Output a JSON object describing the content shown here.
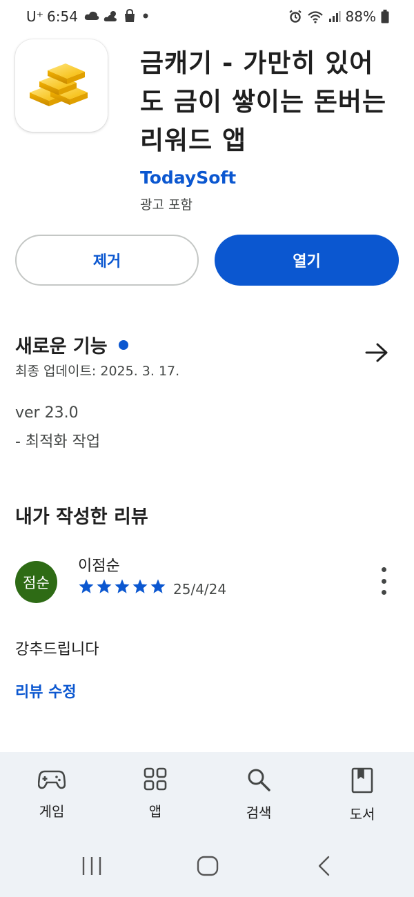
{
  "status_bar": {
    "carrier": "U⁺",
    "time": "6:54",
    "battery": "88%"
  },
  "app": {
    "title": "금캐기 - 가만히 있어도 금이 쌓이는 돈버는 리워드 앱",
    "developer": "TodaySoft",
    "ads_label": "광고 포함",
    "icon": "gold-bars-icon"
  },
  "actions": {
    "remove_label": "제거",
    "open_label": "열기"
  },
  "whats_new": {
    "title": "새로운 기능",
    "updated": "최종 업데이트: 2025. 3. 17.",
    "version": "ver 23.0",
    "note": "- 최적화 작업"
  },
  "my_review": {
    "title": "내가 작성한 리뷰",
    "avatar_text": "점순",
    "reviewer_name": "이점순",
    "rating": 5,
    "max_rating": 5,
    "date": "25/4/24",
    "body": "강추드립니다",
    "edit_label": "리뷰 수정"
  },
  "bottom_nav": {
    "items": [
      {
        "label": "게임",
        "icon": "gamepad-icon"
      },
      {
        "label": "앱",
        "icon": "apps-grid-icon"
      },
      {
        "label": "검색",
        "icon": "search-icon"
      },
      {
        "label": "도서",
        "icon": "book-icon"
      }
    ]
  },
  "colors": {
    "accent": "#0b57d0",
    "avatar": "#2e6b15",
    "nav_background": "#eef2f6"
  }
}
